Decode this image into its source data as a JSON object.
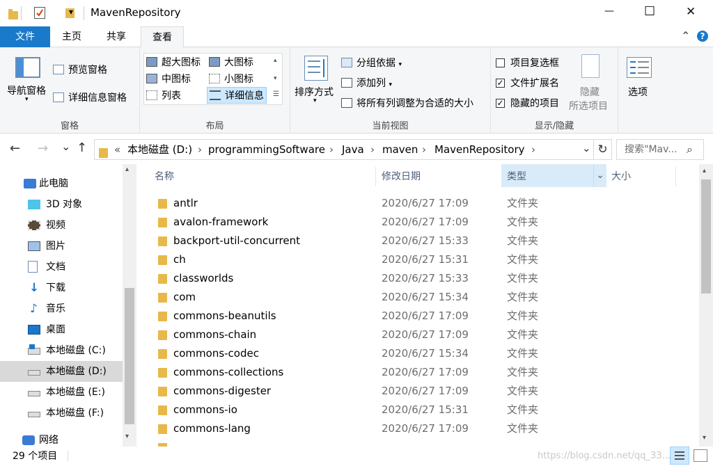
{
  "window": {
    "title": "MavenRepository",
    "qat_dropdown_glyph": "▾",
    "minimize_glyph": "—",
    "maximize_glyph": "☐",
    "close_glyph": "✕"
  },
  "ribbon_tabs": {
    "file": "文件",
    "home": "主页",
    "share": "共享",
    "view": "查看",
    "collapse_glyph": "⌃",
    "help_glyph": "?"
  },
  "ribbon": {
    "panes": {
      "label": "窗格",
      "nav_pane": "导航窗格",
      "preview_pane": "预览窗格",
      "details_pane": "详细信息窗格"
    },
    "layout": {
      "label": "布局",
      "extra_large": "超大图标",
      "large": "大图标",
      "medium": "中图标",
      "small": "小图标",
      "list": "列表",
      "details": "详细信息"
    },
    "current_view": {
      "label": "当前视图",
      "sort_by": "排序方式",
      "group_by": "分组依据",
      "add_columns": "添加列",
      "size_all_columns": "将所有列调整为合适的大小"
    },
    "show_hide": {
      "label": "显示/隐藏",
      "item_checkboxes": "项目复选框",
      "file_extensions": "文件扩展名",
      "hidden_items": "隐藏的项目",
      "hide_selected_line1": "隐藏",
      "hide_selected_line2": "所选项目",
      "item_checkboxes_checked": false,
      "file_extensions_checked": true,
      "hidden_items_checked": true
    },
    "options": "选项"
  },
  "address": {
    "back_glyph": "←",
    "forward_glyph": "→",
    "recent_glyph": "⌄",
    "up_glyph": "↑",
    "overflow": "«",
    "crumbs": [
      "本地磁盘 (D:)",
      "programmingSoftware",
      "Java",
      "maven",
      "MavenRepository"
    ],
    "separator": "›",
    "dropdown_glyph": "⌄",
    "refresh_glyph": "↻",
    "search_placeholder": "搜索\"Mav...",
    "search_glyph": "⌕"
  },
  "nav_pane": {
    "items": [
      {
        "label": "此电脑",
        "icon": "pc-icon"
      },
      {
        "label": "3D 对象",
        "icon": "cube-icon"
      },
      {
        "label": "视频",
        "icon": "video-icon"
      },
      {
        "label": "图片",
        "icon": "pictures-icon"
      },
      {
        "label": "文档",
        "icon": "document-icon"
      },
      {
        "label": "下载",
        "icon": "download-icon"
      },
      {
        "label": "音乐",
        "icon": "music-icon"
      },
      {
        "label": "桌面",
        "icon": "desktop-icon"
      },
      {
        "label": "本地磁盘 (C:)",
        "icon": "windows-drive-icon"
      },
      {
        "label": "本地磁盘 (D:)",
        "icon": "drive-icon"
      },
      {
        "label": "本地磁盘 (E:)",
        "icon": "drive-icon"
      },
      {
        "label": "本地磁盘 (F:)",
        "icon": "drive-icon"
      },
      {
        "label": "网络",
        "icon": "network-icon"
      }
    ],
    "selected": "本地磁盘 (D:)"
  },
  "columns": {
    "name": "名称",
    "date": "修改日期",
    "type": "类型",
    "size": "大小",
    "sort_glyph": "^",
    "filter_glyph": "⌄"
  },
  "files": [
    {
      "name": "antlr",
      "date": "2020/6/27 17:09",
      "type": "文件夹"
    },
    {
      "name": "avalon-framework",
      "date": "2020/6/27 17:09",
      "type": "文件夹"
    },
    {
      "name": "backport-util-concurrent",
      "date": "2020/6/27 15:33",
      "type": "文件夹"
    },
    {
      "name": "ch",
      "date": "2020/6/27 15:31",
      "type": "文件夹"
    },
    {
      "name": "classworlds",
      "date": "2020/6/27 15:33",
      "type": "文件夹"
    },
    {
      "name": "com",
      "date": "2020/6/27 15:34",
      "type": "文件夹"
    },
    {
      "name": "commons-beanutils",
      "date": "2020/6/27 17:09",
      "type": "文件夹"
    },
    {
      "name": "commons-chain",
      "date": "2020/6/27 17:09",
      "type": "文件夹"
    },
    {
      "name": "commons-codec",
      "date": "2020/6/27 15:34",
      "type": "文件夹"
    },
    {
      "name": "commons-collections",
      "date": "2020/6/27 17:09",
      "type": "文件夹"
    },
    {
      "name": "commons-digester",
      "date": "2020/6/27 17:09",
      "type": "文件夹"
    },
    {
      "name": "commons-io",
      "date": "2020/6/27 15:31",
      "type": "文件夹"
    },
    {
      "name": "commons-lang",
      "date": "2020/6/27 17:09",
      "type": "文件夹"
    }
  ],
  "status": {
    "item_count": "29 个项目",
    "watermark": "https://blog.csdn.net/qq_33..."
  },
  "colors": {
    "accent": "#1979ca",
    "folder": "#e8b84a",
    "selection": "#cce8ff",
    "nav_selected": "#d9d9d9"
  }
}
